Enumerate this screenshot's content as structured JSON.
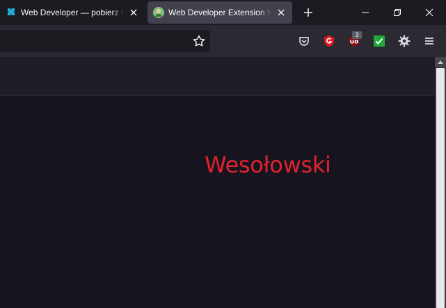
{
  "tabs": [
    {
      "title": "Web Developer — pobierz to rozszerzenie do Firefoksa",
      "active": false,
      "favicon": "puzzle-icon"
    },
    {
      "title": "Web Developer Extension for Firefox",
      "active": true,
      "favicon": "avatar-icon"
    }
  ],
  "toolbar": {
    "icons": [
      "star-icon",
      "pocket-icon",
      "shield-icon",
      "ublock-icon",
      "checkmark-icon",
      "gear-icon",
      "menu-icon"
    ],
    "ublock_badge": "3"
  },
  "page": {
    "name": "Wesołowski"
  },
  "colors": {
    "accent_red": "#e2222c",
    "page_bg": "#15141f",
    "tab_active": "#42414d"
  }
}
